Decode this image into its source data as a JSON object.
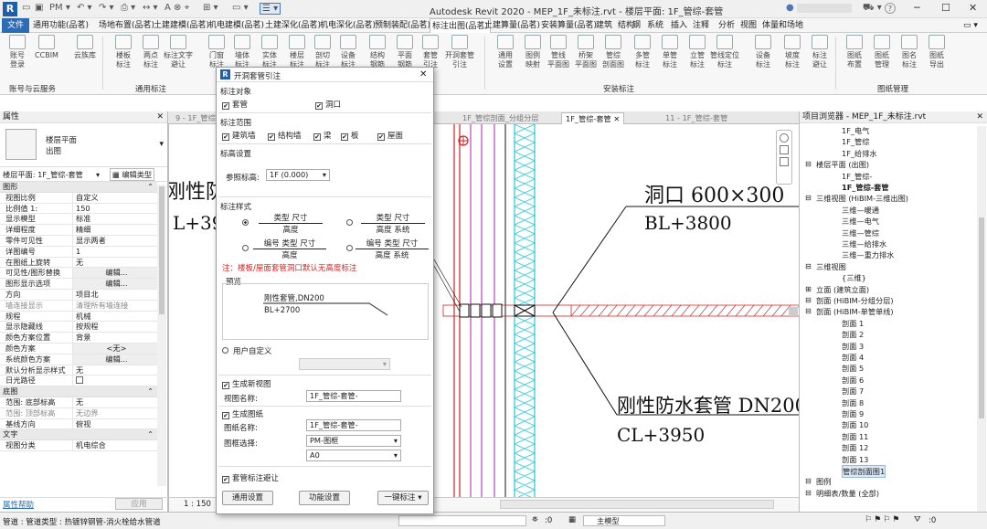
{
  "titlebar": {
    "logo": "R",
    "qa_labels": [
      "PM ▾",
      "▭ ▾"
    ],
    "title": "Autodesk Revit 2020 - MEP_1F_未标注.rvt - 楼层平面: 1F_管综-套管",
    "user": "▲",
    "help": "?"
  },
  "menu": [
    "文件",
    "通用功能(品茗)",
    "场地布置(品茗)",
    "土建建模(品茗)",
    "机电建模(品茗)",
    "土建深化(品茗)",
    "机电深化(品茗)",
    "预制装配(品茗)",
    "标注出图(品茗)",
    "土建算量(品茗)",
    "安装算量(品茗)",
    "建筑",
    "结构",
    "钢",
    "系统",
    "插入",
    "注释",
    "分析",
    "视图",
    "体量和场地"
  ],
  "ribbon": {
    "buttons": [
      "账号\n登录",
      "CCBIM",
      "云族库",
      "楼板\n标注",
      "两点\n标注",
      "标注文字\n避让",
      "门窗\n标注",
      "墙体\n标注",
      "实体\n标注",
      "楼层\n标注",
      "剖切\n标注",
      "设备\n标注",
      "结构\n钢筋",
      "平面\n钢筋",
      "套管\n引注",
      "开洞套管\n引注",
      "通用\n设置",
      "图例\n映射",
      "管线\n平面图",
      "桥架\n平面图",
      "管综\n剖面图",
      "多管\n标注",
      "单管\n标注",
      "立管\n标注",
      "管线定位\n标注",
      "设备\n标注",
      "坡度\n标注",
      "标注\n避让",
      "图纸\n布置",
      "图纸\n管理",
      "图名\n标注",
      "图纸\n导出"
    ],
    "groups": [
      "账号与云服务",
      "通用标注",
      "安装标注",
      "图纸管理"
    ]
  },
  "properties": {
    "title": "属性",
    "type_line1": "楼层平面",
    "type_line2": "出图",
    "selector": "楼层平面: 1F_管综-套管",
    "edit_type": "编辑类型",
    "sections": [
      {
        "name": "图形",
        "rows": [
          [
            "视图比例",
            "自定义"
          ],
          [
            "比例值 1:",
            "150"
          ],
          [
            "显示模型",
            "标准"
          ],
          [
            "详细程度",
            "精细"
          ],
          [
            "零件可见性",
            "显示两者"
          ],
          [
            "详图编号",
            "1"
          ],
          [
            "在图纸上旋转",
            "无"
          ],
          [
            "可见性/图形替换",
            "编辑..."
          ],
          [
            "图形显示选项",
            "编辑..."
          ],
          [
            "方向",
            "项目北"
          ],
          [
            "墙连接显示",
            "清理所有墙连接"
          ],
          [
            "规程",
            "机械"
          ],
          [
            "显示隐藏线",
            "按规程"
          ],
          [
            "颜色方案位置",
            "背景"
          ],
          [
            "颜色方案",
            "<无>"
          ],
          [
            "系统颜色方案",
            "编辑..."
          ],
          [
            "默认分析显示样式",
            "无"
          ],
          [
            "日光路径",
            ""
          ]
        ]
      },
      {
        "name": "底图",
        "rows": [
          [
            "范围: 底部标高",
            "无"
          ],
          [
            "范围: 顶部标高",
            "无边界"
          ],
          [
            "基线方向",
            "俯视"
          ]
        ]
      },
      {
        "name": "文字",
        "rows": [
          [
            "视图分类",
            "机电综合"
          ]
        ]
      }
    ],
    "help": "属性帮助",
    "apply": "应用"
  },
  "tabs": [
    "9 - 1F_管综-套管",
    "1F_管综剖面_分组分层",
    "1F_管综-套管",
    "11 - 1F_管综-套管"
  ],
  "canvas": {
    "left_text1": "刚性防",
    "left_text2": "L+395",
    "hole_label": "洞口 600×300",
    "hole_level": "BL+3800",
    "sleeve_label": "刚性防水套管 DN200",
    "sleeve_level": "CL+3950",
    "scale": "1 : 150"
  },
  "dialog": {
    "title": "开洞套管引注",
    "target_label": "标注对象",
    "targets": [
      "套管",
      "洞口"
    ],
    "range_label": "标注范围",
    "ranges": [
      "建筑墙",
      "结构墙",
      "梁",
      "板",
      "屋面"
    ],
    "elev_label": "标高设置",
    "ref_label": "参照标高:",
    "ref_value": "1F (0.000)",
    "style_label": "标注样式",
    "styles": [
      [
        "类型 尺寸",
        "高度"
      ],
      [
        "类型 尺寸",
        "高度 系统"
      ],
      [
        "编号 类型 尺寸",
        "高度"
      ],
      [
        "编号 类型 尺寸",
        "高度 系统"
      ]
    ],
    "note": "注：楼板/屋面套管洞口默认无高度标注",
    "preview_label": "预览",
    "preview_text1": "刚性套管,DN200",
    "preview_text2": "BL+2700",
    "custom_label": "用户自定义",
    "newview_label": "生成新视图",
    "view_name_label": "视图名称:",
    "view_name": "1F_管综-套管-",
    "sheet_label": "生成图纸",
    "sheet_name_label": "图纸名称:",
    "sheet_name": "1F_管综-套管-",
    "frame_label": "图框选择:",
    "frame_value": "PM-图框",
    "size_value": "A0",
    "avoid_label": "套管标注避让",
    "btn_general": "通用设置",
    "btn_func": "功能设置",
    "btn_one": "一键标注"
  },
  "browser": {
    "title": "项目浏览器 - MEP_1F_未标注.rvt",
    "items": [
      [
        "1F_电气",
        2
      ],
      [
        "1F_管综",
        2
      ],
      [
        "1F_给排水",
        2
      ],
      [
        "楼层平面 (出图)",
        1
      ],
      [
        "1F_管综-",
        2
      ],
      [
        "1F_管综-套管",
        2
      ],
      [
        "三维视图 (HiBIM-三维出图)",
        1
      ],
      [
        "三维—暖通",
        2
      ],
      [
        "三维—电气",
        2
      ],
      [
        "三维—管综",
        2
      ],
      [
        "三维—给排水",
        2
      ],
      [
        "三维—重力排水",
        2
      ],
      [
        "三维视图",
        1
      ],
      [
        "{三维}",
        2
      ],
      [
        "立面 (建筑立面)",
        1
      ],
      [
        "剖面 (HiBIM-分组分层)",
        1
      ],
      [
        "剖面 (HiBIM-单管单线)",
        1
      ],
      [
        "剖面 1",
        2
      ],
      [
        "剖面 2",
        2
      ],
      [
        "剖面 3",
        2
      ],
      [
        "剖面 4",
        2
      ],
      [
        "剖面 5",
        2
      ],
      [
        "剖面 6",
        2
      ],
      [
        "剖面 7",
        2
      ],
      [
        "剖面 8",
        2
      ],
      [
        "剖面 9",
        2
      ],
      [
        "剖面 10",
        2
      ],
      [
        "剖面 11",
        2
      ],
      [
        "剖面 12",
        2
      ],
      [
        "剖面 13",
        2
      ],
      [
        "管综剖面图1",
        2
      ],
      [
        "图例",
        1
      ],
      [
        "明细表/数量 (全部)",
        1
      ]
    ]
  },
  "status": {
    "text": "管道 : 管道类型 : 热镀锌钢管-消火栓给水管道",
    "zero": ":0",
    "model": "主模型",
    "zero2": ":0"
  },
  "colors": {
    "accent": "#2b6cb6",
    "red_pipe": "#d42020",
    "cyan": "#28c8d8",
    "magenta": "#c040c0"
  }
}
